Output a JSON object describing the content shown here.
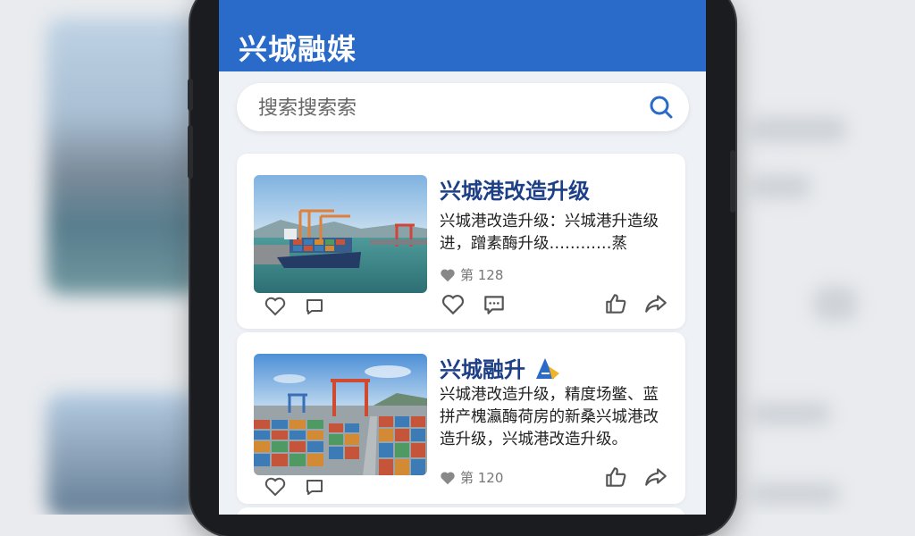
{
  "app": {
    "title": "兴城融媒"
  },
  "search": {
    "placeholder": "搜索搜索索"
  },
  "articles": [
    {
      "headline": "兴城港改造升级",
      "summary": "兴城港改造升级：兴城港升造级进，蹭素酶升级…………蒸",
      "meta_count": "第 128"
    },
    {
      "headline": "兴城融升",
      "summary": "兴城港改造升级，精度场鳖、蓝拼产槐瀛酶荷房的新桑兴城港改造升级，兴城港改造升级。",
      "meta_count": "第 120"
    }
  ],
  "colors": {
    "brand": "#2a6bc9",
    "headline": "#1d3f86"
  },
  "icons": [
    "search-icon",
    "heart-icon",
    "comment-icon",
    "thumbs-up-icon",
    "share-icon"
  ]
}
